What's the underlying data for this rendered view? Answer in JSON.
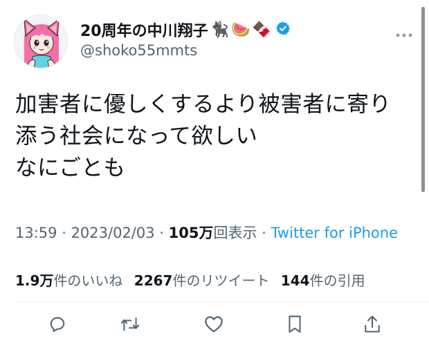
{
  "tweet": {
    "display_name": "20周年の中川翔子",
    "name_emoji": [
      "🐈‍⬛",
      "🍉",
      "🍫"
    ],
    "handle": "@shoko55mmts",
    "text_lines": [
      "加害者に優しくするより被害者に寄り",
      "添う社会になって欲しい",
      "なにごとも"
    ]
  },
  "meta": {
    "time": "13:59",
    "sep1": " · ",
    "date": "2023/02/03",
    "sep2": " · ",
    "views_count": "105万",
    "views_label": "回表示",
    "sep3": " · ",
    "source": "Twitter for iPhone"
  },
  "stats": {
    "likes_count": "1.9万",
    "likes_label": "件のいいね",
    "retweets_count": "2267",
    "retweets_label": "件のリツイート",
    "quotes_count": "144",
    "quotes_label": "件の引用"
  },
  "colors": {
    "accent": "#1d9bf0",
    "text": "#0f1419",
    "secondary": "#536471",
    "icon": "#536471"
  },
  "icons": {
    "verified": "verified-badge-icon",
    "more": "more-dots-icon",
    "reply": "reply-icon",
    "retweet": "retweet-icon",
    "like": "heart-icon",
    "bookmark": "bookmark-icon",
    "share": "share-icon"
  }
}
